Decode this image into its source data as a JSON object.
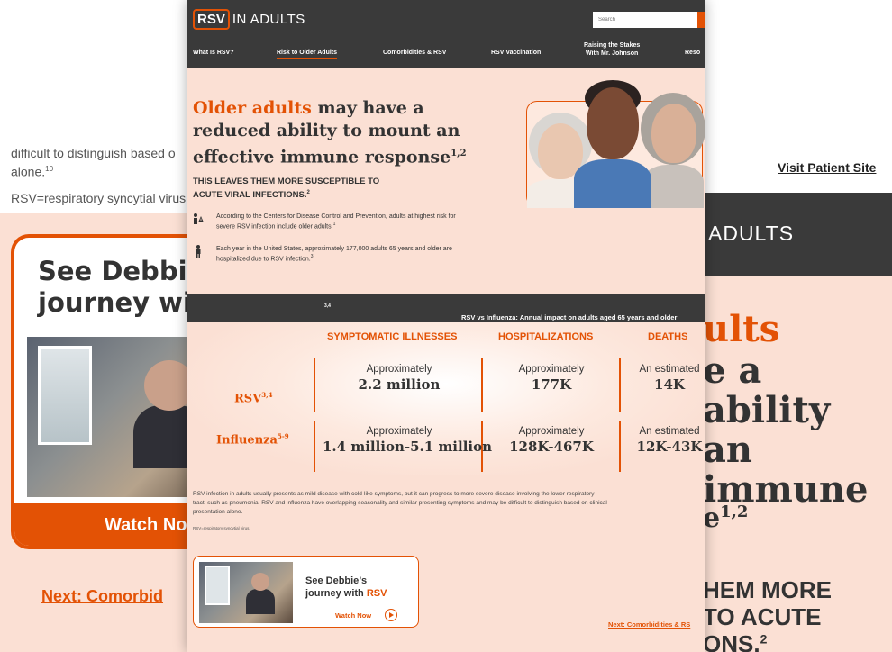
{
  "background_left": {
    "text_line1": "difficult to distinguish based o",
    "text_line2": "alone.",
    "text_line2_sup": "10",
    "abbrev": "RSV=respiratory syncytial virus",
    "card_title_line1": "See Debbie",
    "card_title_line2": "journey wit",
    "watch_label": "Watch No",
    "next_link": "Next: Comorbid"
  },
  "background_right": {
    "visit_link": "Visit Patient Site",
    "header_fragment": "ADULTS",
    "line1": "ults",
    "line2": "e a",
    "line3": "ability",
    "line4": "an",
    "line5": "immune",
    "line6": "e",
    "line6_sup": "1,2",
    "line7": "HEM MORE",
    "line8": "TO ACUTE",
    "line9": "ONS.",
    "line9_sup": "2"
  },
  "header": {
    "logo_box": "RSV",
    "logo_rest": "IN ADULTS",
    "search_placeholder": "Search",
    "nav": [
      "What Is RSV?",
      "Risk to Older Adults",
      "Comorbidities & RSV",
      "RSV Vaccination",
      "Raising the Stakes",
      "With Mr. Johnson",
      "Reso"
    ]
  },
  "hero": {
    "title_orange": "Older adults",
    "title_rest1": " may have a",
    "title_line2": "reduced ability to mount an",
    "title_line3": "effective immune response",
    "title_sup": "1,2",
    "subtitle": "THIS LEAVES THEM MORE SUSCEPTIBLE TO ACUTE VIRAL INFECTIONS.",
    "subtitle_sup": "2"
  },
  "facts": [
    {
      "icon": "warning-people-icon",
      "text": "According to the Centers for Disease Control and Prevention, adults at highest risk for severe RSV infection include older adults.",
      "sup": "1"
    },
    {
      "icon": "person-icon",
      "text": "Each year in the United States, approximately 177,000 adults 65 years and older are hospitalized due to RSV infection.",
      "sup": "3"
    }
  ],
  "comparison": {
    "band_title": "RSV vs Influenza: Annual impact on adults aged 65 years and older",
    "band_sup": "3,4",
    "columns": [
      "SYMPTOMATIC ILLNESSES",
      "HOSPITALIZATIONS",
      "DEATHS"
    ],
    "rows": [
      {
        "label": "RSV",
        "sup": "3,4",
        "cells": [
          {
            "prefix": "Approximately",
            "value": "2.2 million"
          },
          {
            "prefix": "Approximately",
            "value": "177K"
          },
          {
            "prefix": "An estimated",
            "value": "14K"
          }
        ]
      },
      {
        "label": "Influenza",
        "sup": "5-9",
        "cells": [
          {
            "prefix": "Approximately",
            "value": "1.4 million-5.1 million"
          },
          {
            "prefix": "Approximately",
            "value": "128K-467K"
          },
          {
            "prefix": "An estimated",
            "value": "12K-43K"
          }
        ]
      }
    ]
  },
  "footnote": "RSV infection in adults usually presents as mild disease with cold-like symptoms, but it can progress to more severe disease involving the lower respiratory tract, such as pneumonia. RSV and influenza have overlapping seasonality and similar presenting symptoms and may be difficult to distinguish based on clinical presentation alone.",
  "footnote_sup1": "1",
  "footnote_sup2": "10",
  "abbrev": "RSV=respiratory syncytial virus.",
  "video": {
    "title_line1": "See Debbie’s",
    "title_line2": "journey with ",
    "title_orange": "RSV",
    "watch_label": "Watch Now"
  },
  "next_link": "Next: Comorbidities & RS",
  "colors": {
    "accent": "#e35205",
    "header_bg": "#3a3a3a",
    "page_bg": "#fbe0d4"
  }
}
